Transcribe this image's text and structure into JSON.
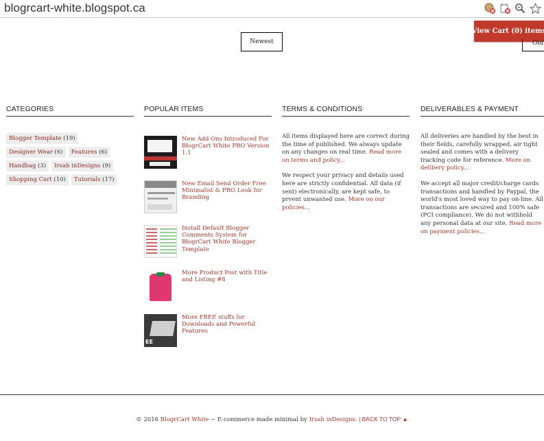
{
  "browser": {
    "url": "blogrcart-white.blogspot.ca",
    "icons": [
      "blocked-cookie-icon",
      "blocked-plugin-icon",
      "zoom-icon",
      "bookmark-star-icon"
    ]
  },
  "header": {
    "view_cart_label": "View Cart (0) items",
    "newest_label": "Newest",
    "older_label_partial": "Old"
  },
  "categories": {
    "title": "CATEGORIES",
    "labels": [
      {
        "name": "Blogger Template",
        "count": "(19)"
      },
      {
        "name": "Designer Wear",
        "count": "(6)"
      },
      {
        "name": "Features",
        "count": "(6)"
      },
      {
        "name": "Handbag",
        "count": "(3)"
      },
      {
        "name": "Irsah inDesigns",
        "count": "(9)"
      },
      {
        "name": "Shopping Cart",
        "count": "(10)"
      },
      {
        "name": "Tutorials",
        "count": "(17)"
      }
    ]
  },
  "popular": {
    "title": "POPULAR ITEMS",
    "items": [
      {
        "title": "New Add Ons Introduced For BlogrCart White PRO Version 1.1"
      },
      {
        "title": "New Email Send Order Free Minimalist & PRO Look for Branding"
      },
      {
        "title": "Install Default Blogger Comments System for BlogrCart White Blogger Template"
      },
      {
        "title": "More Product Post with Title and Listing #8"
      },
      {
        "title": "More FREE stuffs for Downloads and Powerful Features"
      }
    ],
    "thumb5_text": "EE"
  },
  "terms": {
    "title": "TERMS & CONDITIONS",
    "p1": "All items displayed here are correct during the time of published. We always update on any changes on real time. ",
    "p1_link": "Read more on terms and policy...",
    "p2": "We respect your privacy and details used here are strictly confidential. All data (if sent) electronically, are kept safe, to prvent unwanted use. ",
    "p2_link": "More on our policies..."
  },
  "deliverables": {
    "title": "DELIVERABLES & PAYMENT",
    "p1": "All deliveries are handled by the best in their fields, carefully wrapped, air tight sealed and comes with a delivery tracking code for reference. ",
    "p1_link": "More on delibery policy...",
    "p2": "We accept all major credit/charge cards transactions and handled by Paypal, the world's most loved way to pay on-line. All transactions are secured and 100% safe (PCI compliance). We do not withhold any personal data at our site. ",
    "p2_link": "Read more on payment policies..."
  },
  "footer": {
    "copyright": "© 2016 ",
    "brand": "BlogrCart White",
    "middle": " ~ E-commerce made minimal by ",
    "author": "Irsah inDesigns.",
    "sep": " | ",
    "back_to_top": "BACK TO TOP ▲"
  },
  "colors": {
    "accent": "#c0392b",
    "link": "#a8382a"
  }
}
